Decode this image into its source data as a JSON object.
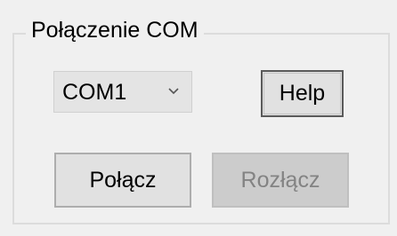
{
  "group": {
    "title": "Połączenie COM"
  },
  "port_select": {
    "selected": "COM1",
    "arrow_icon": "chevron-down-icon"
  },
  "buttons": {
    "help_label": "Help",
    "connect_label": "Połącz",
    "disconnect_label": "Rozłącz",
    "disconnect_enabled": false
  },
  "colors": {
    "background": "#f0f0f0",
    "button_face": "#e1e1e1",
    "button_disabled_face": "#cccccc",
    "disabled_text": "#838383"
  }
}
